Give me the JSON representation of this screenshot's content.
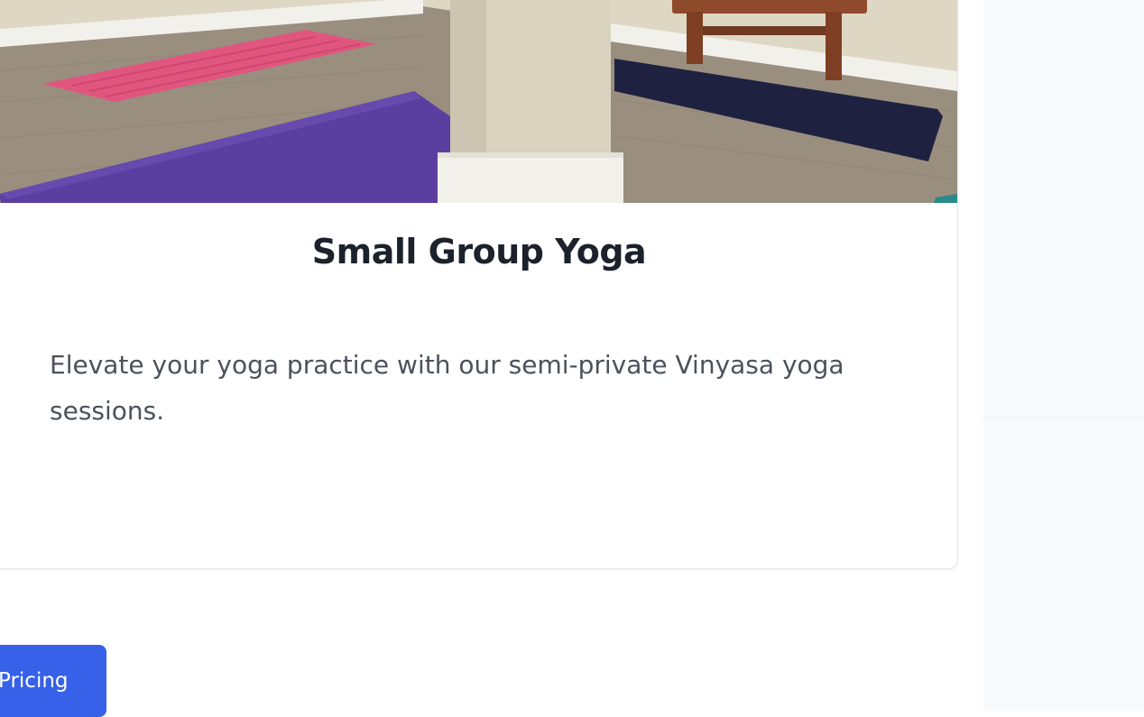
{
  "card": {
    "title": "Small Group Yoga",
    "description": "Elevate your yoga practice with our semi-private Vinyasa yoga sessions."
  },
  "actions": {
    "pricing_label": "Pricing"
  },
  "colors": {
    "accent": "#3661e8",
    "title_text": "#1c222b",
    "body_text": "#4b525c"
  }
}
